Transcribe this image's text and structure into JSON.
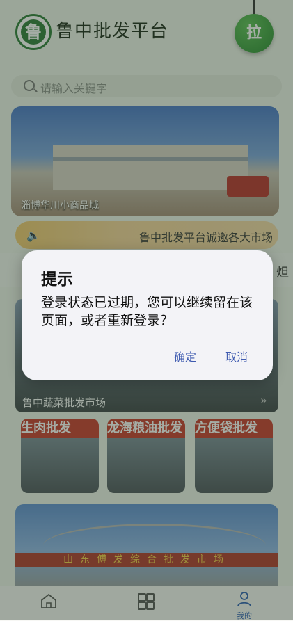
{
  "header": {
    "title": "鲁中批发平台",
    "logo_text": "鲁",
    "pull_button": "拉"
  },
  "search": {
    "placeholder": "请输入关键字"
  },
  "banner": {
    "caption": "淄博华川小商品城"
  },
  "notice": {
    "text": "鲁中批发平台诚邀各大市场"
  },
  "market": {
    "caption": "鲁中蔬菜批发市场"
  },
  "thumbs": [
    {
      "sign": "生肉批发"
    },
    {
      "sign": "龙海粮油批发"
    },
    {
      "sign": "方便袋批发"
    }
  ],
  "big_image": {
    "sign": "山东傅发综合批发市场"
  },
  "tabbar": {
    "me_label": "我的"
  },
  "dialog": {
    "title": "提示",
    "message": "登录状态已过期，您可以继续留在该页面，或者重新登录？",
    "confirm": "确定",
    "cancel": "取消"
  },
  "colors": {
    "accent": "#3f5bb0",
    "brand_green": "#2f7d3a"
  }
}
